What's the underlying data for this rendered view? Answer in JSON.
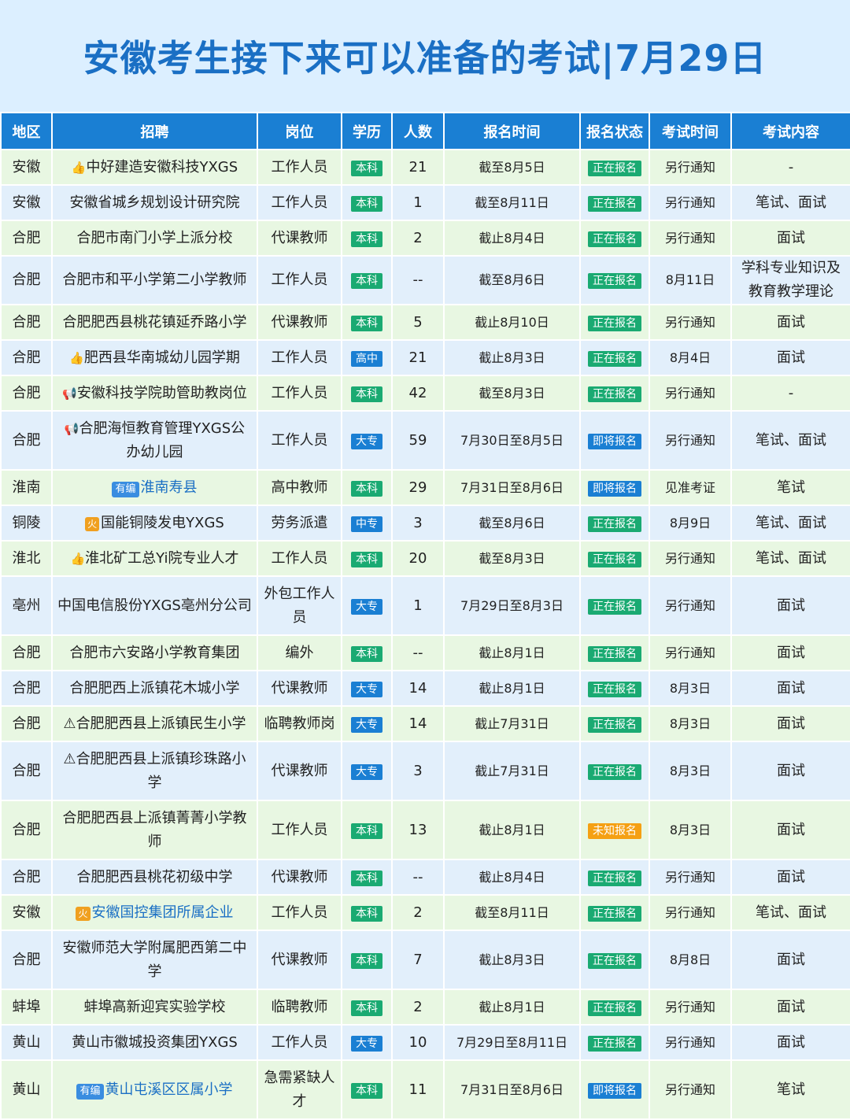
{
  "title": "安徽考生接下来可以准备的考试|7月29日",
  "headers": [
    "地区",
    "招聘",
    "岗位",
    "学历",
    "人数",
    "报名时间",
    "报名状态",
    "考试时间",
    "考试内容"
  ],
  "rows": [
    {
      "region": "安徽",
      "prefix": "👍",
      "name": "中好建造安徽科技YXGS",
      "position": "工作人员",
      "edu": "本科",
      "count": "21",
      "reg": "截至8月5日",
      "status": "正在报名",
      "exam": "另行通知",
      "content": "-"
    },
    {
      "region": "安徽",
      "prefix": "",
      "name": "安徽省城乡规划设计研究院",
      "position": "工作人员",
      "edu": "本科",
      "count": "1",
      "reg": "截至8月11日",
      "status": "正在报名",
      "exam": "另行通知",
      "content": "笔试、面试"
    },
    {
      "region": "合肥",
      "prefix": "",
      "name": "合肥市南门小学上派分校",
      "position": "代课教师",
      "edu": "本科",
      "count": "2",
      "reg": "截止8月4日",
      "status": "正在报名",
      "exam": "另行通知",
      "content": "面试"
    },
    {
      "region": "合肥",
      "prefix": "",
      "name": "合肥市和平小学第二小学教师",
      "position": "工作人员",
      "edu": "本科",
      "count": "--",
      "reg": "截至8月6日",
      "status": "正在报名",
      "exam": "8月11日",
      "content": "学科专业知识及教育教学理论"
    },
    {
      "region": "合肥",
      "prefix": "",
      "name": "合肥肥西县桃花镇延乔路小学",
      "position": "代课教师",
      "edu": "本科",
      "count": "5",
      "reg": "截止8月10日",
      "status": "正在报名",
      "exam": "另行通知",
      "content": "面试"
    },
    {
      "region": "合肥",
      "prefix": "👍",
      "name": "肥西县华南城幼儿园学期",
      "position": "工作人员",
      "edu": "高中",
      "count": "21",
      "reg": "截止8月3日",
      "status": "正在报名",
      "exam": "8月4日",
      "content": "面试"
    },
    {
      "region": "合肥",
      "prefix": "📢",
      "name": "安徽科技学院助管助教岗位",
      "position": "工作人员",
      "edu": "本科",
      "count": "42",
      "reg": "截至8月3日",
      "status": "正在报名",
      "exam": "另行通知",
      "content": "-"
    },
    {
      "region": "合肥",
      "prefix": "📢",
      "name": "合肥海恒教育管理YXGS公办幼儿园",
      "position": "工作人员",
      "edu": "大专",
      "count": "59",
      "reg": "7月30日至8月5日",
      "status": "即将报名",
      "exam": "另行通知",
      "content": "笔试、面试"
    },
    {
      "region": "淮南",
      "prefix": "有编",
      "name": "淮南寿县",
      "position": "高中教师",
      "edu": "本科",
      "count": "29",
      "reg": "7月31日至8月6日",
      "status": "即将报名",
      "exam": "见准考证",
      "content": "笔试"
    },
    {
      "region": "铜陵",
      "prefix": "火",
      "name": "国能铜陵发电YXGS",
      "position": "劳务派遣",
      "edu": "中专",
      "count": "3",
      "reg": "截至8月6日",
      "status": "正在报名",
      "exam": "8月9日",
      "content": "笔试、面试"
    },
    {
      "region": "淮北",
      "prefix": "👍",
      "name": "淮北矿工总Yi院专业人才",
      "position": "工作人员",
      "edu": "本科",
      "count": "20",
      "reg": "截至8月3日",
      "status": "正在报名",
      "exam": "另行通知",
      "content": "笔试、面试"
    },
    {
      "region": "亳州",
      "prefix": "",
      "name": "中国电信股份YXGS亳州分公司",
      "position": "外包工作人员",
      "edu": "大专",
      "count": "1",
      "reg": "7月29日至8月3日",
      "status": "正在报名",
      "exam": "另行通知",
      "content": "面试"
    },
    {
      "region": "合肥",
      "prefix": "",
      "name": "合肥市六安路小学教育集团",
      "position": "编外",
      "edu": "本科",
      "count": "--",
      "reg": "截止8月1日",
      "status": "正在报名",
      "exam": "另行通知",
      "content": "面试"
    },
    {
      "region": "合肥",
      "prefix": "",
      "name": "合肥肥西上派镇花木城小学",
      "position": "代课教师",
      "edu": "大专",
      "count": "14",
      "reg": "截止8月1日",
      "status": "正在报名",
      "exam": "8月3日",
      "content": "面试"
    },
    {
      "region": "合肥",
      "prefix": "⚠",
      "name": "合肥肥西县上派镇民生小学",
      "position": "临聘教师岗",
      "edu": "大专",
      "count": "14",
      "reg": "截止7月31日",
      "status": "正在报名",
      "exam": "8月3日",
      "content": "面试"
    },
    {
      "region": "合肥",
      "prefix": "⚠",
      "name": "合肥肥西县上派镇珍珠路小学",
      "position": "代课教师",
      "edu": "大专",
      "count": "3",
      "reg": "截止7月31日",
      "status": "正在报名",
      "exam": "8月3日",
      "content": "面试"
    },
    {
      "region": "合肥",
      "prefix": "",
      "name": "合肥肥西县上派镇菁菁小学教师",
      "position": "工作人员",
      "edu": "本科",
      "count": "13",
      "reg": "截止8月1日",
      "status": "未知报名",
      "exam": "8月3日",
      "content": "面试"
    },
    {
      "region": "合肥",
      "prefix": "",
      "name": "合肥肥西县桃花初级中学",
      "position": "代课教师",
      "edu": "本科",
      "count": "--",
      "reg": "截止8月4日",
      "status": "正在报名",
      "exam": "另行通知",
      "content": "面试"
    },
    {
      "region": "安徽",
      "prefix": "火",
      "name": "安徽国控集团所属企业",
      "position": "工作人员",
      "edu": "本科",
      "count": "2",
      "reg": "截至8月11日",
      "status": "正在报名",
      "exam": "另行通知",
      "content": "笔试、面试"
    },
    {
      "region": "合肥",
      "prefix": "",
      "name": "安徽师范大学附属肥西第二中学",
      "position": "代课教师",
      "edu": "本科",
      "count": "7",
      "reg": "截止8月3日",
      "status": "正在报名",
      "exam": "8月8日",
      "content": "面试"
    },
    {
      "region": "蚌埠",
      "prefix": "",
      "name": "蚌埠高新迎宾实验学校",
      "position": "临聘教师",
      "edu": "本科",
      "count": "2",
      "reg": "截止8月1日",
      "status": "正在报名",
      "exam": "另行通知",
      "content": "面试"
    },
    {
      "region": "黄山",
      "prefix": "",
      "name": "黄山市徽城投资集团YXGS",
      "position": "工作人员",
      "edu": "大专",
      "count": "10",
      "reg": "7月29日至8月11日",
      "status": "正在报名",
      "exam": "另行通知",
      "content": "面试"
    },
    {
      "region": "黄山",
      "prefix": "有编",
      "name": "黄山屯溪区区属小学",
      "position": "急需紧缺人才",
      "edu": "本科",
      "count": "11",
      "reg": "7月31日至8月6日",
      "status": "即将报名",
      "exam": "另行通知",
      "content": "笔试"
    }
  ]
}
